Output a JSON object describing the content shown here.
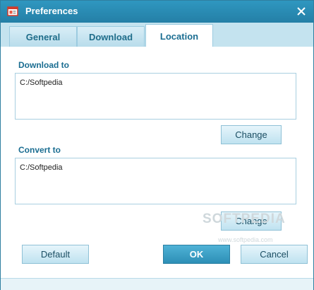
{
  "window": {
    "title": "Preferences"
  },
  "icons": {
    "app": "app-icon",
    "close": "close-icon"
  },
  "tabs": [
    {
      "label": "General",
      "active": false
    },
    {
      "label": "Download",
      "active": false
    },
    {
      "label": "Location",
      "active": true
    }
  ],
  "location": {
    "download_label": "Download to",
    "download_path": "C:/Softpedia",
    "download_change": "Change",
    "convert_label": "Convert to",
    "convert_path": "C:/Softpedia",
    "convert_change": "Change"
  },
  "footer": {
    "default_label": "Default",
    "ok_label": "OK",
    "cancel_label": "Cancel"
  },
  "watermark": {
    "text": "SOFTPEDIA",
    "url": "www.softpedia.com"
  },
  "colors": {
    "titlebar": "#247fa6",
    "tab_active_text": "#1a6d91",
    "accent": "#2d8fb6"
  }
}
